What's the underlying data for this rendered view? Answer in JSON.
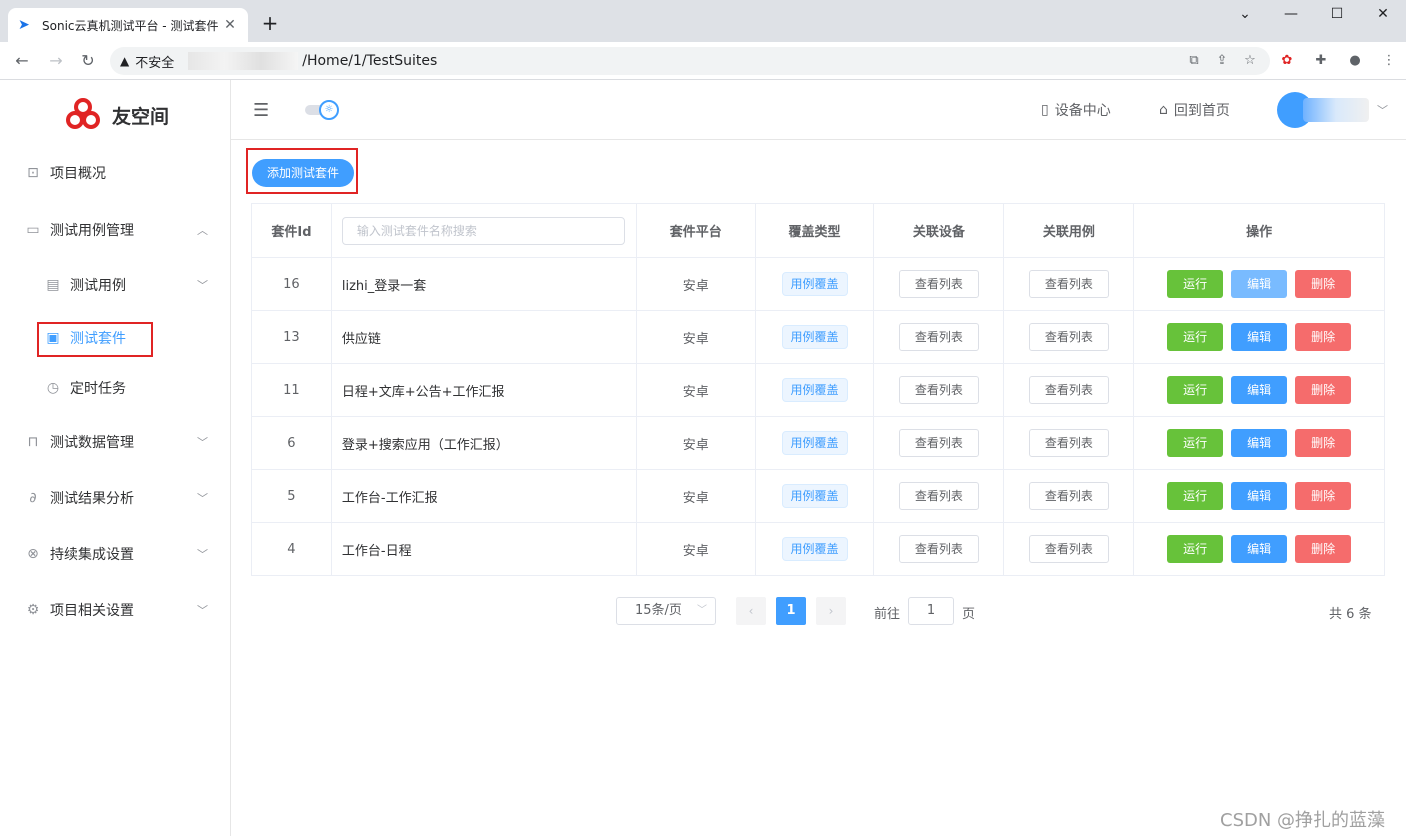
{
  "browser": {
    "tab_title": "Sonic云真机测试平台 - 测试套件",
    "insecure_label": "不安全",
    "url": "/Home/1/TestSuites"
  },
  "brand": {
    "name": "友空间",
    "accent": "#409eff"
  },
  "sidebar": {
    "items": [
      {
        "label": "项目概况",
        "icon": "presentation-icon"
      },
      {
        "label": "测试用例管理",
        "icon": "folder-icon",
        "expanded": true
      },
      {
        "label": "测试用例",
        "icon": "document-icon"
      },
      {
        "label": "测试套件",
        "icon": "suite-icon",
        "active": true
      },
      {
        "label": "定时任务",
        "icon": "timer-icon"
      },
      {
        "label": "测试数据管理",
        "icon": "lock-icon"
      },
      {
        "label": "测试结果分析",
        "icon": "paperclip-icon"
      },
      {
        "label": "持续集成设置",
        "icon": "link-icon"
      },
      {
        "label": "项目相关设置",
        "icon": "gear-icon"
      }
    ]
  },
  "header": {
    "device_center": "设备中心",
    "back_home": "回到首页"
  },
  "toolbar": {
    "add_suite_label": "添加测试套件"
  },
  "table": {
    "headers": {
      "id": "套件Id",
      "search_placeholder": "输入测试套件名称搜索",
      "platform": "套件平台",
      "coverage": "覆盖类型",
      "devices": "关联设备",
      "cases": "关联用例",
      "ops": "操作"
    },
    "rows": [
      {
        "id": "16",
        "name": "lizhi_登录一套",
        "platform": "安卓",
        "coverage": "用例覆盖",
        "devices": "查看列表",
        "cases": "查看列表",
        "run": "运行",
        "edit": "编辑",
        "del": "删除"
      },
      {
        "id": "13",
        "name": "供应链",
        "platform": "安卓",
        "coverage": "用例覆盖",
        "devices": "查看列表",
        "cases": "查看列表",
        "run": "运行",
        "edit": "编辑",
        "del": "删除"
      },
      {
        "id": "11",
        "name": "日程+文库+公告+工作汇报",
        "platform": "安卓",
        "coverage": "用例覆盖",
        "devices": "查看列表",
        "cases": "查看列表",
        "run": "运行",
        "edit": "编辑",
        "del": "删除"
      },
      {
        "id": "6",
        "name": "登录+搜索应用（工作汇报）",
        "platform": "安卓",
        "coverage": "用例覆盖",
        "devices": "查看列表",
        "cases": "查看列表",
        "run": "运行",
        "edit": "编辑",
        "del": "删除"
      },
      {
        "id": "5",
        "name": "工作台-工作汇报",
        "platform": "安卓",
        "coverage": "用例覆盖",
        "devices": "查看列表",
        "cases": "查看列表",
        "run": "运行",
        "edit": "编辑",
        "del": "删除"
      },
      {
        "id": "4",
        "name": "工作台-日程",
        "platform": "安卓",
        "coverage": "用例覆盖",
        "devices": "查看列表",
        "cases": "查看列表",
        "run": "运行",
        "edit": "编辑",
        "del": "删除"
      }
    ]
  },
  "pagination": {
    "page_size": "15条/页",
    "current_page": "1",
    "goto_prefix": "前往",
    "goto_value": "1",
    "goto_suffix": "页",
    "total": "共 6 条"
  },
  "watermark": "CSDN @挣扎的蓝藻"
}
